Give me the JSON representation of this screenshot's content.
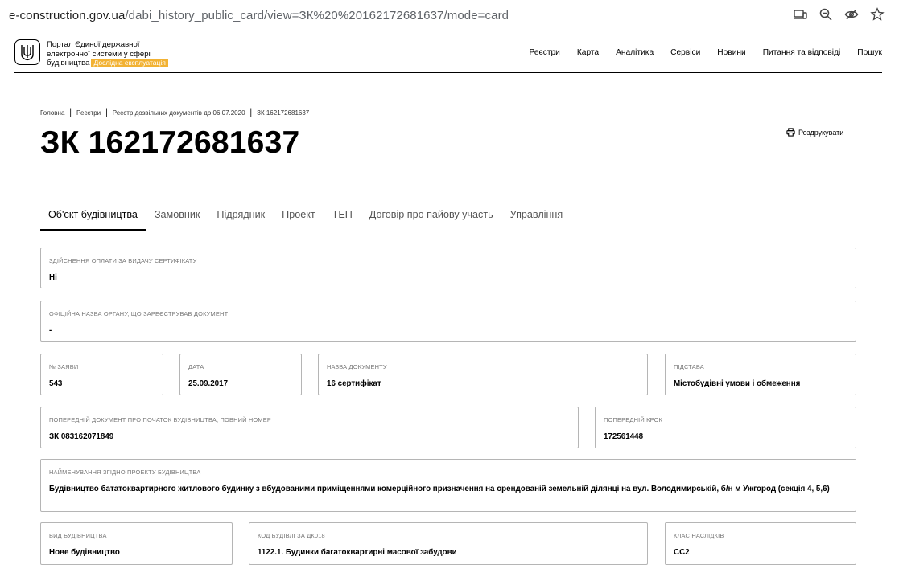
{
  "browser": {
    "url_host": "e-construction.gov.ua",
    "url_path": "/dabi_history_public_card/view=ЗК%20%20162172681637/mode=card"
  },
  "header": {
    "portal_name": "Портал Єдиної державної електронної системи у сфері будівництва",
    "badge": "Дослідна експлуатація",
    "nav": [
      "Реєстри",
      "Карта",
      "Аналітика",
      "Сервіси",
      "Новини",
      "Питання та відповіді",
      "Пошук"
    ]
  },
  "breadcrumb": [
    "Головна",
    "Реєстри",
    "Реєстр дозвільних документів до 06.07.2020",
    "ЗК 162172681637"
  ],
  "print_label": "Роздрукувати",
  "title": "ЗК 162172681637",
  "tabs": [
    "Об'єкт будівництва",
    "Замовник",
    "Підрядник",
    "Проект",
    "ТЕП",
    "Договір про пайову участь",
    "Управління"
  ],
  "active_tab": 0,
  "fields": {
    "payment": {
      "label": "Здійснення оплати за видачу сертифікату",
      "value": "Ні"
    },
    "authority": {
      "label": "Офіційна назва органу, що зареєстрував документ",
      "value": "-"
    },
    "app_no": {
      "label": "№ заяви",
      "value": "543"
    },
    "date": {
      "label": "Дата",
      "value": "25.09.2017"
    },
    "doc_name": {
      "label": "Назва документу",
      "value": "16 сертифікат"
    },
    "basis": {
      "label": "Підстава",
      "value": "Містобудівні умови і обмеження"
    },
    "prev_doc": {
      "label": "Попередній документ про початок будівництва, повний номер",
      "value": "ЗК 083162071849"
    },
    "prev_step": {
      "label": "Попередній крок",
      "value": "172561448"
    },
    "project_name": {
      "label": "Найменування згідно проекту будівництва",
      "value": "Будівництво бататоквартирного житлового будинку з вбудованими приміщеннями комерційного призначення на орендованій земельній ділянці на вул. Володимирській, б/н м Ужгород (секція 4, 5,6)"
    },
    "construction_type": {
      "label": "Вид будівництва",
      "value": "Нове будівництво"
    },
    "building_code": {
      "label": "Код будівлі за ДК018",
      "value": "1122.1. Будинки багатоквартирні масової забудови"
    },
    "consequence_class": {
      "label": "Клас наслідків",
      "value": "СС2"
    }
  }
}
